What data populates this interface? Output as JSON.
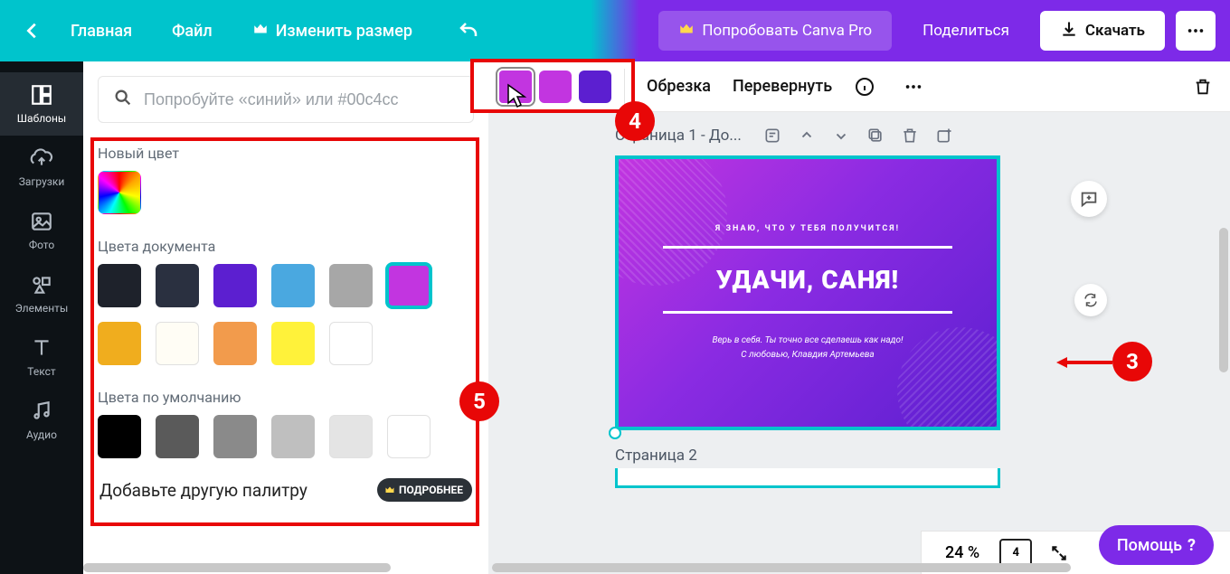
{
  "topbar": {
    "home": "Главная",
    "file": "Файл",
    "resize": "Изменить размер",
    "try_pro": "Попробовать Canva Pro",
    "share": "Поделиться",
    "download": "Скачать"
  },
  "leftnav": {
    "templates": "Шаблоны",
    "uploads": "Загрузки",
    "photos": "Фото",
    "elements": "Элементы",
    "text": "Текст",
    "audio": "Аудио"
  },
  "search": {
    "placeholder": "Попробуйте «синий» или #00c4cc"
  },
  "panel": {
    "new_color": "Новый цвет",
    "doc_colors": "Цвета документа",
    "default_colors": "Цвета по умолчанию",
    "add_palette": "Добавьте другую палитру",
    "more": "ПОДРОБНЕЕ",
    "doc_swatches": [
      "#1e222b",
      "#2a3040",
      "#5c1fd0",
      "#4aa8e0",
      "#a7a7a7",
      "#c235e0",
      "#f0ad1e",
      "#fffdf5",
      "#f29b4c",
      "#fff23a",
      "#ffffff"
    ],
    "selected_doc_swatch_index": 5,
    "default_swatches": [
      "#000000",
      "#5a5a5a",
      "#8a8a8a",
      "#bfbfbf",
      "#e4e4e4",
      "#ffffff"
    ]
  },
  "ctx": {
    "slots": [
      "#c235e0",
      "#c235e0",
      "#5c1fd0"
    ],
    "selected_slot_index": 0,
    "crop": "Обрезка",
    "flip": "Перевернуть"
  },
  "canvas": {
    "page1_title": "Страница 1 - До...",
    "card": {
      "line1": "Я ЗНАЮ, ЧТО У ТЕБЯ ПОЛУЧИТСЯ!",
      "main": "УДАЧИ, САНЯ!",
      "sub1": "Верь в себя. Ты точно все сделаешь как надо!",
      "sub2": "С любовью, Клавдия Артемьева"
    },
    "page2_title": "Страница 2"
  },
  "bottom": {
    "zoom": "24 %",
    "page_count": "4"
  },
  "help": "Помощь",
  "annotations": {
    "n3": "3",
    "n4": "4",
    "n5": "5"
  }
}
